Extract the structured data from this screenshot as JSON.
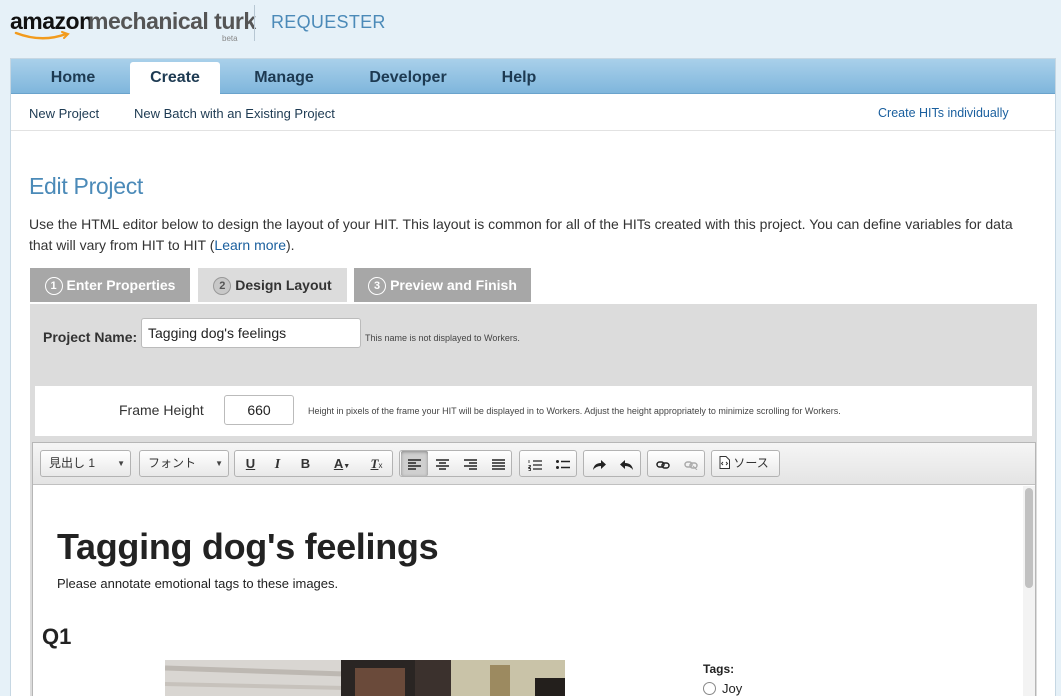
{
  "header": {
    "logo_amazon": "amazon",
    "logo_mturk": "mechanical turk",
    "logo_beta": "beta",
    "requester": "REQUESTER"
  },
  "nav": {
    "tabs": [
      {
        "label": "Home"
      },
      {
        "label": "Create"
      },
      {
        "label": "Manage"
      },
      {
        "label": "Developer"
      },
      {
        "label": "Help"
      }
    ],
    "active": "Create"
  },
  "subnav": {
    "new_project": "New Project",
    "new_batch": "New Batch with an Existing Project",
    "create_individually": "Create HITs individually"
  },
  "page": {
    "title": "Edit Project",
    "intro_text": "Use the HTML editor below to design the layout of your HIT. This layout is common for all of the HITs created with this project. You can define variables for data that will vary from HIT to HIT (",
    "learn_more": "Learn more",
    "intro_close": ")."
  },
  "steps": [
    {
      "num": "1",
      "label": "Enter Properties"
    },
    {
      "num": "2",
      "label": "Design Layout"
    },
    {
      "num": "3",
      "label": "Preview and Finish"
    }
  ],
  "form": {
    "project_name_label": "Project Name:",
    "project_name_value": "Tagging dog's feelings",
    "project_name_hint": "This name is not displayed to Workers.",
    "frame_height_label": "Frame Height",
    "frame_height_value": "660",
    "frame_height_hint": "Height in pixels of the frame your HIT will be displayed in to Workers. Adjust the height appropriately to minimize scrolling for Workers."
  },
  "toolbar": {
    "format_combo": "見出し 1",
    "font_combo": "フォント",
    "underline": "U",
    "italic": "I",
    "bold": "B",
    "text_color": "A",
    "clear_format": "T",
    "source_label": "ソース"
  },
  "hit": {
    "title": "Tagging dog's feelings",
    "description": "Please annotate emotional tags to these images.",
    "question": "Q1",
    "tags_label": "Tags:",
    "tag_options": [
      "Joy"
    ]
  },
  "colors": {
    "accent": "#4b8ab8",
    "nav_bg": "#8fc2e4",
    "link": "#1a5f9e"
  }
}
